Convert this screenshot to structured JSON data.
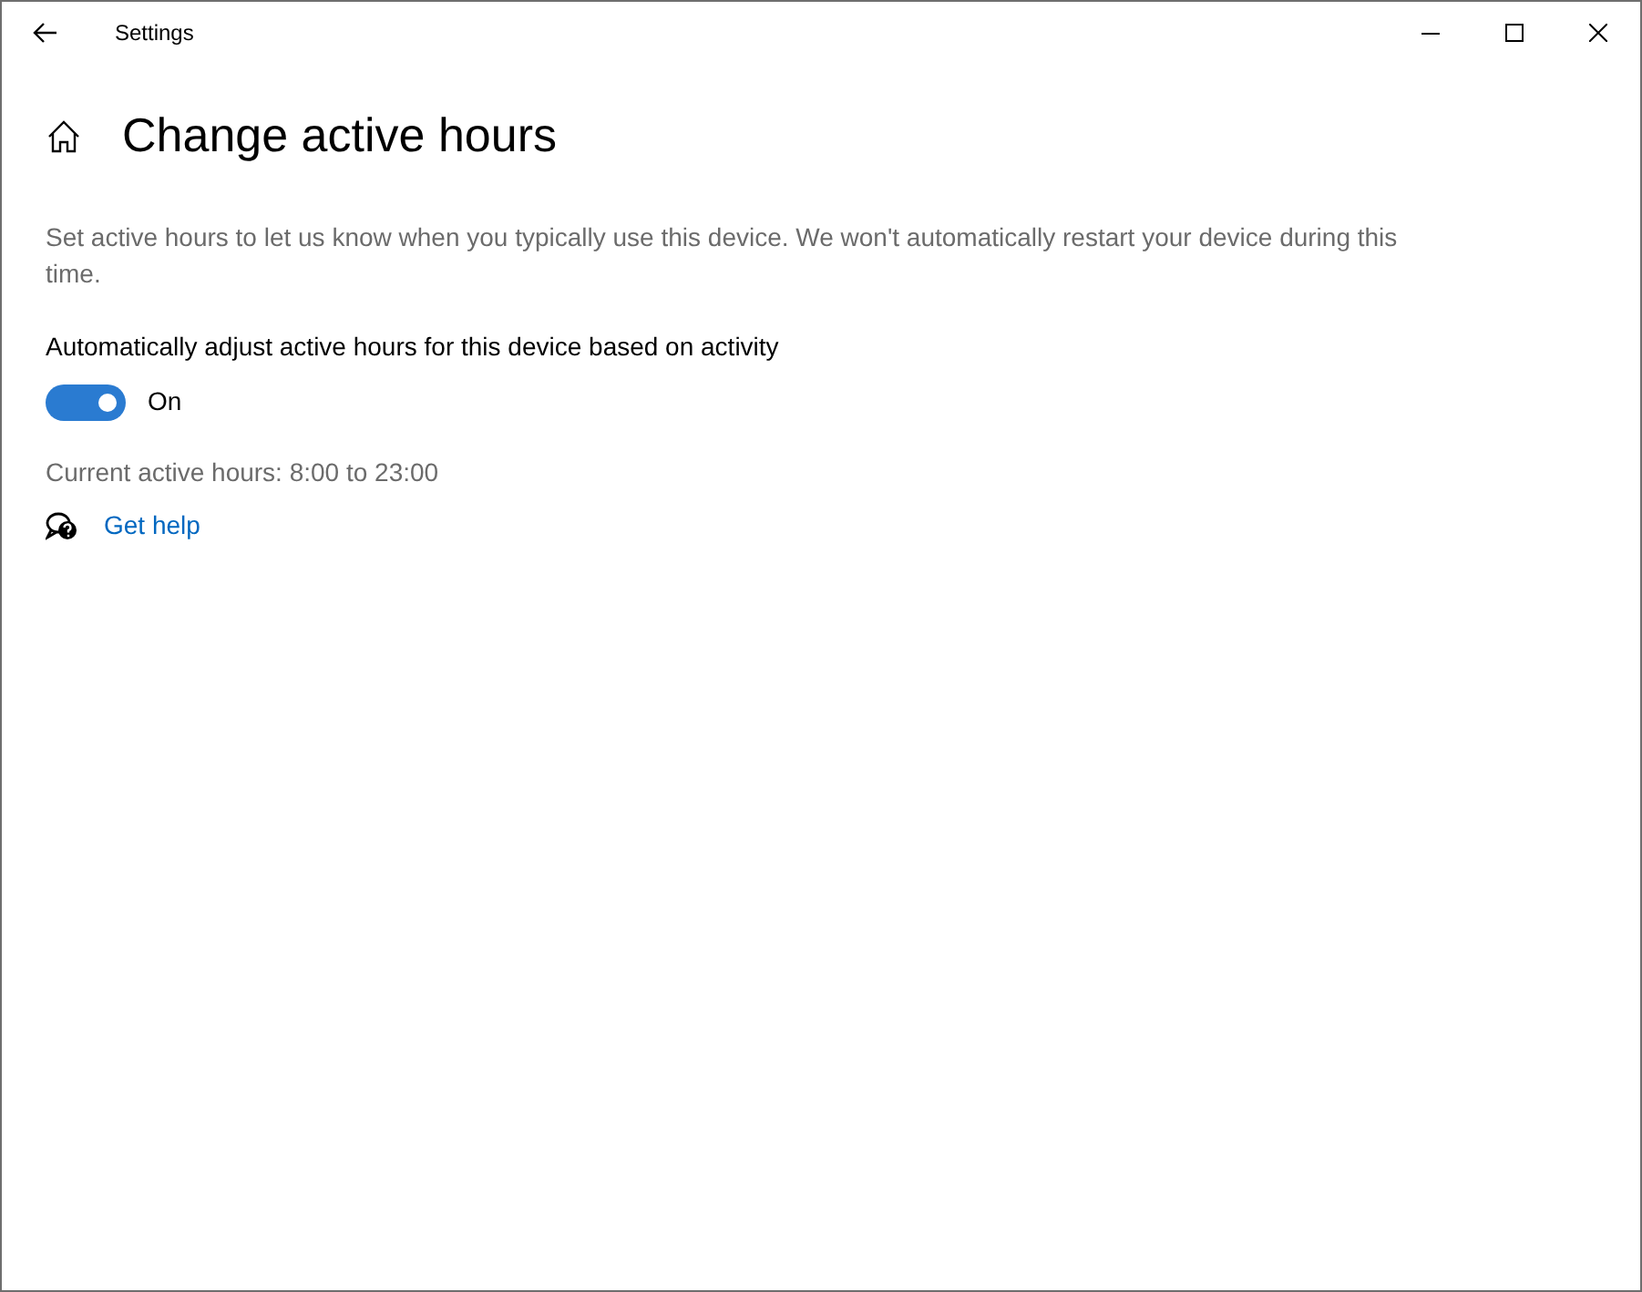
{
  "window": {
    "title": "Settings"
  },
  "page": {
    "title": "Change active hours",
    "description": "Set active hours to let us know when you typically use this device. We won't automatically restart your device during this time."
  },
  "toggle": {
    "label": "Automatically adjust active hours for this device based on activity",
    "on": true,
    "state_text": "On"
  },
  "current_hours": "Current active hours: 8:00 to 23:00",
  "help_link": "Get help"
}
